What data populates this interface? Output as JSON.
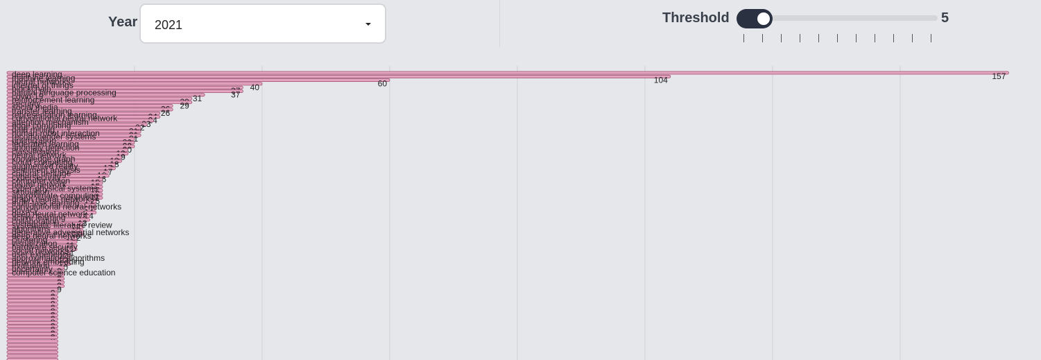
{
  "controls": {
    "year_label": "Year",
    "year_value": "2021",
    "threshold_label": "Threshold",
    "threshold_value": "5",
    "threshold_ticks": 11
  },
  "colors": {
    "bar_fill": "#e3a5bf",
    "bar_stroke": "#a04a70",
    "grid": "#cfd0d4",
    "background": "#e6e7eb"
  },
  "chart_data": {
    "type": "bar",
    "orientation": "horizontal",
    "xlim": [
      0,
      160
    ],
    "grid": true,
    "categories": [
      "deep learning",
      "machine learning",
      "neural networks",
      "internet of things",
      "blockchain",
      "natural language processing",
      "covid-19",
      "reinforcement learning",
      "security",
      "social media",
      "transfer learning",
      "representation learning",
      "convolutional neural network",
      "attention mechanism",
      "edge computing",
      "data mining",
      "human-robot interaction",
      "recommender systems",
      "optimization",
      "federated learning",
      "anomaly detection",
      "classification",
      "neural network",
      "knowledge graph",
      "cloud computing",
      "augmented reality",
      "sentiment analysis",
      "cultural heritage",
      "cybersecurity",
      "computer vision",
      "neural network",
      "cyber-physical systems",
      "simulation",
      "approximate computing",
      "graph neural networks",
      "multi-task learning",
      "convolutional neural networks",
      "privacy",
      "deep neural network",
      "active learning",
      "collaboration",
      "systematic literature review",
      "algorithms",
      "generative adversarial networks",
      "deep neural networks",
      "clustering",
      "visualization",
      "hardware security",
      "social networks",
      "user experience",
      "approximation algorithms",
      "network embedding",
      "evaluation",
      "uncertainty",
      "computer science education"
    ],
    "values": [
      157,
      104,
      60,
      40,
      37,
      37,
      31,
      29,
      29,
      26,
      26,
      24,
      24,
      23,
      22,
      21,
      21,
      21,
      20,
      20,
      20,
      19,
      19,
      18,
      18,
      17,
      17,
      16,
      16,
      15,
      15,
      15,
      15,
      15,
      15,
      14,
      14,
      14,
      14,
      13,
      13,
      12,
      12,
      12,
      12,
      11,
      11,
      11,
      11,
      10,
      10,
      10,
      10,
      9,
      9,
      9,
      9,
      9,
      9,
      8,
      8,
      8,
      8,
      8,
      8,
      8,
      8,
      8,
      8,
      8,
      8,
      8,
      8,
      8,
      8,
      8,
      8,
      8,
      8
    ],
    "value_labels": [
      "157",
      "104",
      "60",
      "40",
      "37",
      "37",
      "31",
      "29",
      "29",
      "26",
      "26",
      "24",
      "24",
      "23",
      "22",
      "21",
      "21",
      "21",
      "20",
      "20",
      "20",
      "19",
      "19",
      "18",
      "18",
      "17",
      "17",
      "16",
      "16",
      "15",
      "15",
      "15",
      "15",
      "15",
      "15",
      "14",
      "14",
      "14",
      "14",
      "13",
      "13",
      "12",
      "12",
      "12",
      "12",
      "11",
      "11",
      "11",
      "11",
      "10",
      "10",
      "10",
      "10",
      "9",
      "9",
      "9",
      "9",
      "9",
      "9",
      "8",
      "8",
      "8",
      "8",
      "8",
      "8",
      "8",
      "8",
      "8",
      "8",
      "8",
      "8",
      "8"
    ]
  }
}
